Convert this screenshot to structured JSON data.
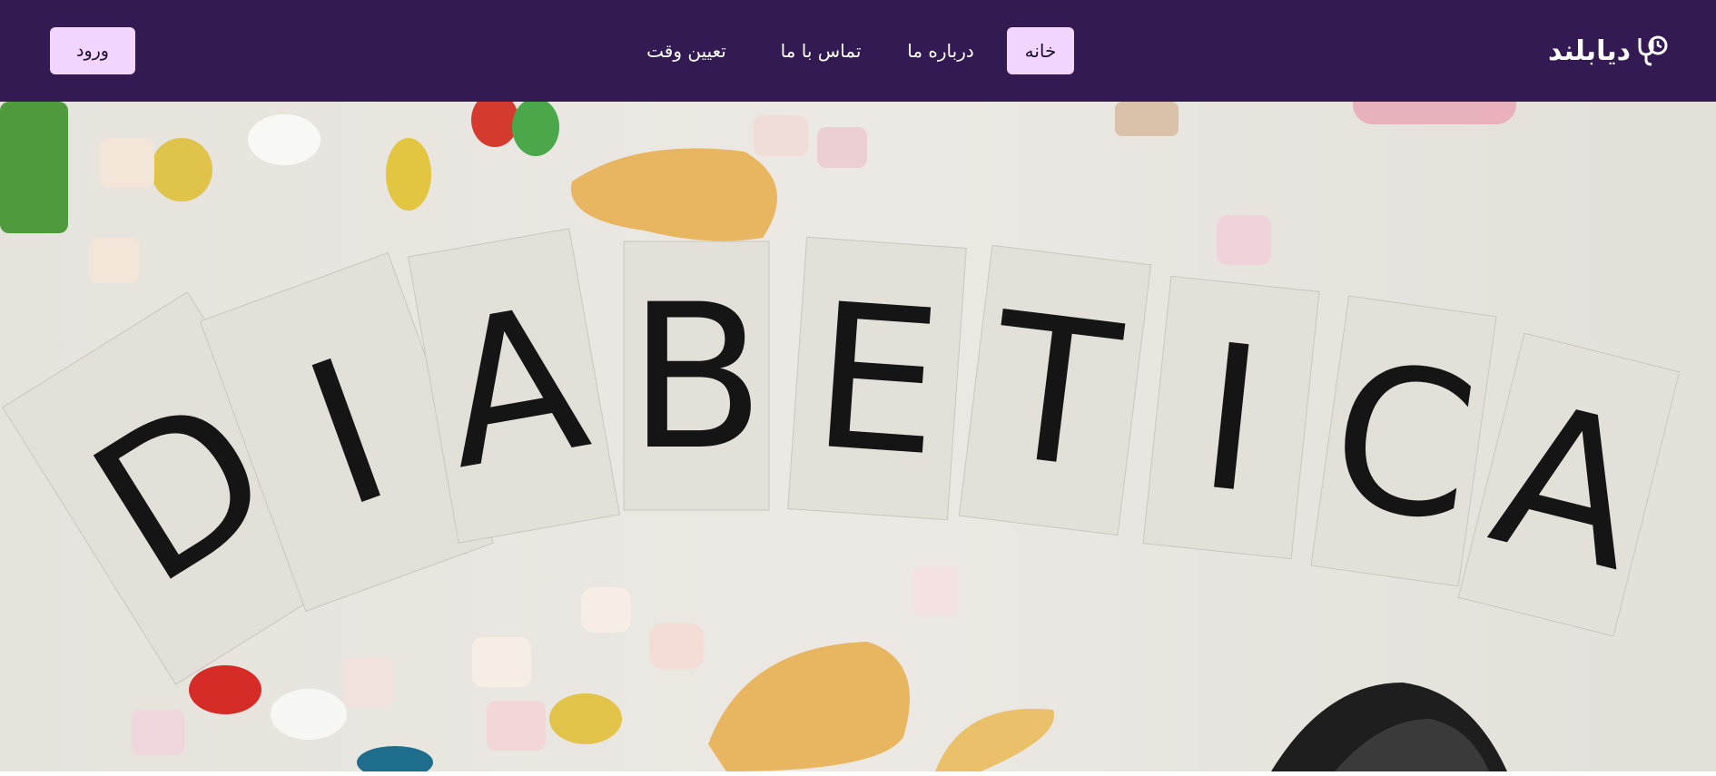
{
  "header": {
    "logo_text": "دیابلند",
    "logo_icon": "stethoscope-heart-icon",
    "login_label": "ورود",
    "menu": [
      {
        "label": "خانه",
        "active": true
      },
      {
        "label": "درباره ما",
        "active": false
      },
      {
        "label": "تماس با ما",
        "active": false
      },
      {
        "label": "تعیین وقت",
        "active": false
      }
    ]
  },
  "hero": {
    "letters": [
      "D",
      "I",
      "A",
      "B",
      "E",
      "T",
      "I",
      "C",
      "A"
    ]
  },
  "colors": {
    "nav_bg": "#341a53",
    "active_bg": "#f3d6ff",
    "hero_bg": "#eae7e1"
  }
}
